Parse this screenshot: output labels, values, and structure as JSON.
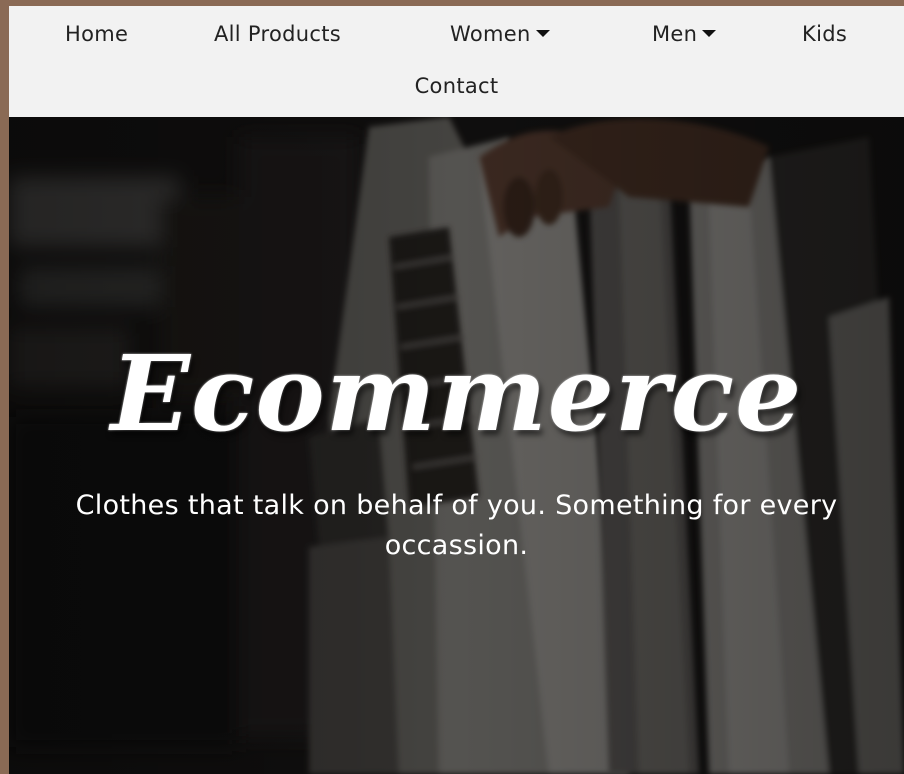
{
  "nav": {
    "home": "Home",
    "all_products": "All Products",
    "women": "Women",
    "men": "Men",
    "kids": "Kids",
    "contact": "Contact"
  },
  "hero": {
    "title": "Ecommerce",
    "subtitle": "Clothes that talk on behalf of you. Something for every occassion."
  },
  "colors": {
    "nav_bg": "#f2f2f2",
    "hero_overlay": "#000000",
    "text_light": "#ffffff"
  }
}
